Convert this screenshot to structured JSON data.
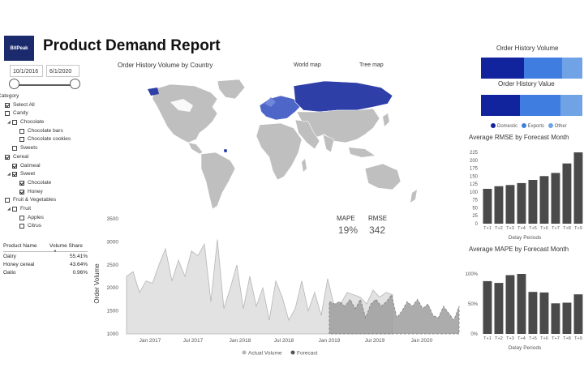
{
  "header": {
    "logo_text": "BitPeak",
    "title": "Product Demand Report"
  },
  "date_range": {
    "start": "10/1/2016",
    "end": "6/1/2020"
  },
  "category_filter": {
    "label": "Category",
    "items": [
      {
        "label": "Select All",
        "level": 0,
        "checked": true
      },
      {
        "label": "Candy",
        "level": 0,
        "checked": false
      },
      {
        "label": "Chocolate",
        "level": 1,
        "checked": false,
        "caret": true
      },
      {
        "label": "Chocolate bars",
        "level": 2,
        "checked": false
      },
      {
        "label": "Chocolate cookies",
        "level": 2,
        "checked": false
      },
      {
        "label": "Sweets",
        "level": 1,
        "checked": false
      },
      {
        "label": "Cereal",
        "level": 0,
        "checked": true
      },
      {
        "label": "Oatmeal",
        "level": 1,
        "checked": true
      },
      {
        "label": "Sweet",
        "level": 1,
        "checked": true,
        "caret": true
      },
      {
        "label": "Chocolate",
        "level": 2,
        "checked": true
      },
      {
        "label": "Honey",
        "level": 2,
        "checked": true
      },
      {
        "label": "Fruit & Vegetables",
        "level": 0,
        "checked": false
      },
      {
        "label": "Fruit",
        "level": 1,
        "checked": false,
        "caret": true
      },
      {
        "label": "Apples",
        "level": 2,
        "checked": false
      },
      {
        "label": "Citrus",
        "level": 2,
        "checked": false
      }
    ]
  },
  "share_table": {
    "headers": [
      "Product Name",
      "Volume Share"
    ],
    "rows": [
      {
        "name": "Oatry",
        "share": "55.41%"
      },
      {
        "name": "Honey cereal",
        "share": "43.64%"
      },
      {
        "name": "Oatio",
        "share": "0.96%"
      }
    ]
  },
  "map_panel": {
    "title": "Order History Volume by Country",
    "tab_world": "World map",
    "tab_tree": "Tree map"
  },
  "kpis": {
    "mape_label": "MAPE",
    "mape_value": "19%",
    "rmse_label": "RMSE",
    "rmse_value": "342"
  },
  "colors": {
    "domestic": "#12239e",
    "exports": "#3f7ee0",
    "other": "#6fa3e6",
    "bar": "#4a4a4a",
    "land": "#bfbfbf",
    "highlight": "#2e3fa8"
  },
  "history_panel": {
    "volume_title": "Order History Volume",
    "value_title": "Order History Value",
    "legend": [
      "Domestic",
      "Exports",
      "Other"
    ]
  },
  "chart_data": [
    {
      "type": "area",
      "ylabel": "Order Volume",
      "ylim": [
        1000,
        3500
      ],
      "yticks": [
        "3500",
        "3000",
        "2500",
        "2000",
        "1500",
        "1000"
      ],
      "xticks": [
        "Jan 2017",
        "Jul 2017",
        "Jan 2018",
        "Jul 2018",
        "Jan 2019",
        "Jul 2019",
        "Jan 2020"
      ],
      "legend": [
        "Actual Volume",
        "Forecast"
      ],
      "series": [
        {
          "name": "Actual Volume",
          "values": [
            2250,
            2350,
            1900,
            2150,
            2100,
            2500,
            2850,
            2150,
            2600,
            2250,
            2800,
            2700,
            2950,
            1700,
            3050,
            1550,
            2000,
            2500,
            1550,
            2250,
            1600,
            2000,
            1300,
            2150,
            1800,
            1300,
            1550,
            2150,
            1500,
            1900,
            1400,
            2200,
            1600,
            1650,
            1900,
            1850,
            1800,
            1650,
            1950,
            1800,
            1900,
            1850
          ]
        },
        {
          "name": "Forecast",
          "values": [
            1700,
            1650,
            1700,
            1600,
            1750,
            1550,
            1750,
            1350,
            1650,
            1750,
            1600,
            1700,
            1850,
            1350,
            1500,
            1700,
            1600,
            1750,
            1550,
            1650,
            1400,
            1350,
            1600,
            1450,
            1300,
            1600
          ]
        }
      ]
    },
    {
      "type": "bar",
      "title": "Average RMSE by Forecast Month",
      "xlabel": "Delay Periods",
      "categories": [
        "T+1",
        "T+2",
        "T+3",
        "T+4",
        "T+5",
        "T+6",
        "T+7",
        "T+8",
        "T+9"
      ],
      "values": [
        110,
        118,
        122,
        128,
        138,
        150,
        160,
        190,
        225
      ],
      "ylim": [
        0,
        225
      ],
      "yticks": [
        "225",
        "200",
        "175",
        "150",
        "125",
        "100",
        "75",
        "50",
        "25",
        "0"
      ]
    },
    {
      "type": "bar",
      "title": "Average MAPE by Forecast Month",
      "xlabel": "Delay Periods",
      "categories": [
        "T+1",
        "T+2",
        "T+3",
        "T+4",
        "T+5",
        "T+6",
        "T+7",
        "T+8",
        "T+9"
      ],
      "values": [
        88,
        85,
        98,
        100,
        70,
        69,
        51,
        52,
        66
      ],
      "ylim": [
        0,
        100
      ],
      "yticks": [
        "100%",
        "50%",
        "0%"
      ]
    }
  ]
}
